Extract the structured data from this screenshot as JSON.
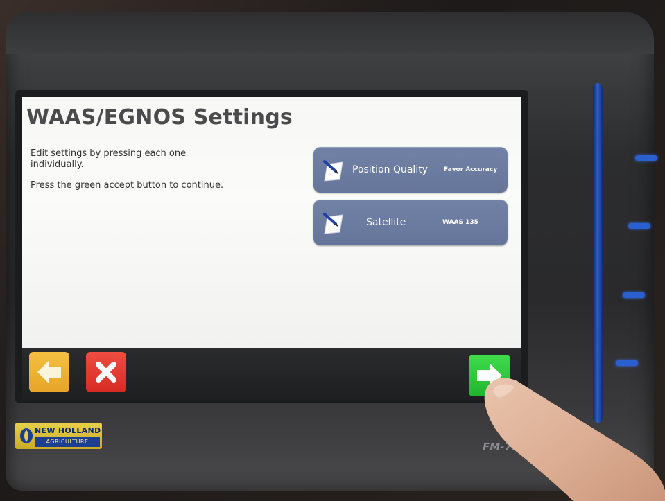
{
  "screen": {
    "title": "WAAS/EGNOS Settings",
    "instructions": [
      "Edit settings by pressing each one individually.",
      "Press the green accept button to continue."
    ]
  },
  "settings": [
    {
      "label": "Position Quality",
      "value": "Favor Accuracy",
      "icon": "pencil-paper-icon"
    },
    {
      "label": "Satellite",
      "value": "WAAS 135",
      "icon": "pencil-paper-icon"
    }
  ],
  "toolbar": {
    "back_icon": "left-arrow-icon",
    "cancel_icon": "close-x-icon",
    "accept_icon": "right-arrow-icon"
  },
  "device": {
    "brand_top": "NEW HOLLAND",
    "brand_bottom": "AGRICULTURE",
    "model": "FM-750"
  },
  "colors": {
    "back_button": "#f0b838",
    "cancel_button": "#e23b31",
    "accept_button": "#2fcb3d",
    "setting_button": "#6c7ba0",
    "bezel_accent": "#2a5fd0"
  }
}
